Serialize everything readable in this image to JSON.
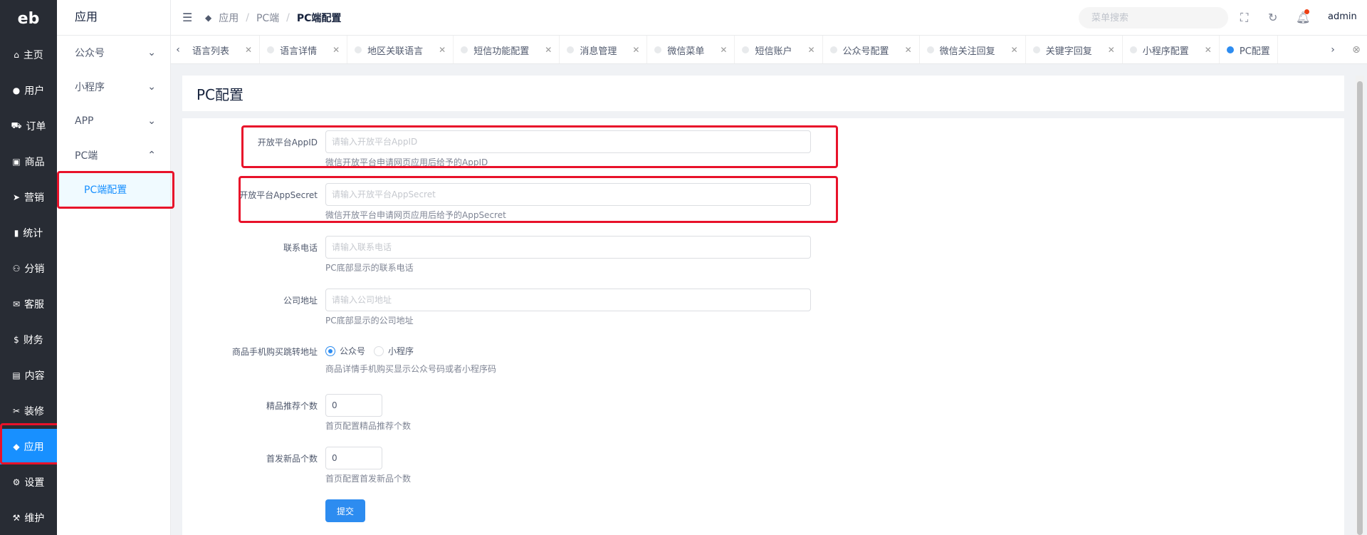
{
  "logo": "eb",
  "rail": [
    {
      "icon": "home-icon",
      "glyph": "⌂",
      "label": "主页"
    },
    {
      "icon": "user-icon",
      "glyph": "●",
      "label": "用户"
    },
    {
      "icon": "cart-icon",
      "glyph": "⛟",
      "label": "订单"
    },
    {
      "icon": "shop-icon",
      "glyph": "▣",
      "label": "商品"
    },
    {
      "icon": "send-icon",
      "glyph": "➤",
      "label": "营销"
    },
    {
      "icon": "chart-icon",
      "glyph": "▮",
      "label": "统计"
    },
    {
      "icon": "share-icon",
      "glyph": "⚇",
      "label": "分销"
    },
    {
      "icon": "chat-icon",
      "glyph": "✉",
      "label": "客服"
    },
    {
      "icon": "dollar-icon",
      "glyph": "$",
      "label": "财务"
    },
    {
      "icon": "book-icon",
      "glyph": "▤",
      "label": "内容"
    },
    {
      "icon": "tools-icon",
      "glyph": "✂",
      "label": "装修"
    },
    {
      "icon": "cube-icon",
      "glyph": "◆",
      "label": "应用"
    },
    {
      "icon": "gear-icon",
      "glyph": "⚙",
      "label": "设置"
    },
    {
      "icon": "wrench-icon",
      "glyph": "⚒",
      "label": "维护"
    }
  ],
  "submenu": {
    "title": "应用",
    "items": [
      {
        "label": "公众号",
        "chevron": "⌄"
      },
      {
        "label": "小程序",
        "chevron": "⌄"
      },
      {
        "label": "APP",
        "chevron": "⌄"
      },
      {
        "label": "PC端",
        "chevron": "⌃"
      }
    ],
    "child": "PC端配置"
  },
  "header": {
    "breadcrumb": [
      "应用",
      "PC端",
      "PC端配置"
    ],
    "search_placeholder": "菜单搜索",
    "user": "admin"
  },
  "tabs": [
    {
      "label": "语言列表",
      "active": false,
      "dot": false
    },
    {
      "label": "语言详情",
      "active": false,
      "dot": true
    },
    {
      "label": "地区关联语言",
      "active": false,
      "dot": true
    },
    {
      "label": "短信功能配置",
      "active": false,
      "dot": true
    },
    {
      "label": "消息管理",
      "active": false,
      "dot": true
    },
    {
      "label": "微信菜单",
      "active": false,
      "dot": true
    },
    {
      "label": "短信账户",
      "active": false,
      "dot": true
    },
    {
      "label": "公众号配置",
      "active": false,
      "dot": true
    },
    {
      "label": "微信关注回复",
      "active": false,
      "dot": true
    },
    {
      "label": "关键字回复",
      "active": false,
      "dot": true
    },
    {
      "label": "小程序配置",
      "active": false,
      "dot": true
    },
    {
      "label": "PC配置",
      "active": true,
      "dot": true
    }
  ],
  "page_title": "PC配置",
  "form": {
    "appid": {
      "label": "开放平台AppID",
      "placeholder": "请输入开放平台AppID",
      "help": "微信开放平台申请网页应用后给予的AppID"
    },
    "appsecret": {
      "label": "开放平台AppSecret",
      "placeholder": "请输入开放平台AppSecret",
      "help": "微信开放平台申请网页应用后给予的AppSecret"
    },
    "phone": {
      "label": "联系电话",
      "placeholder": "请输入联系电话",
      "help": "PC底部显示的联系电话"
    },
    "address": {
      "label": "公司地址",
      "placeholder": "请输入公司地址",
      "help": "PC底部显示的公司地址"
    },
    "jump": {
      "label": "商品手机购买跳转地址",
      "option1": "公众号",
      "option2": "小程序",
      "help": "商品详情手机购买显示公众号码或者小程序码"
    },
    "recommend": {
      "label": "精品推荐个数",
      "value": "0",
      "help": "首页配置精品推荐个数"
    },
    "newgoods": {
      "label": "首发新品个数",
      "value": "0",
      "help": "首页配置首发新品个数"
    },
    "submit": "提交"
  }
}
